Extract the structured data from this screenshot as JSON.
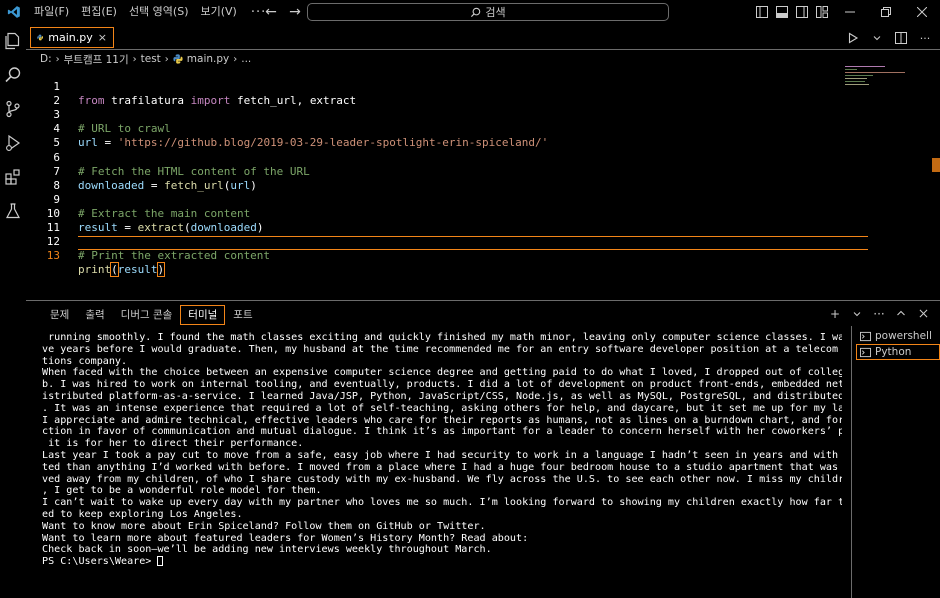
{
  "titlebar": {
    "menu": [
      "파일(F)",
      "편집(E)",
      "선택 영역(S)",
      "보기(V)"
    ],
    "more": "···",
    "search_label": "검색"
  },
  "tab": {
    "filename": "main.py",
    "close": "×"
  },
  "breadcrumb": {
    "parts": [
      "D:",
      "부트캠프 11기",
      "test",
      "main.py",
      "..."
    ]
  },
  "code": {
    "line_numbers": [
      "1",
      "2",
      "3",
      "4",
      "5",
      "6",
      "7",
      "8",
      "9",
      "10",
      "11",
      "12",
      "13"
    ],
    "active_line": "13",
    "l1": {
      "kw1": "from",
      "mod": " trafilatura ",
      "kw2": "import",
      "rest": " fetch_url, extract"
    },
    "l3": "# URL to crawl",
    "l4": {
      "var": "url",
      "op": " = ",
      "str": "'https://github.blog/2019-03-29-leader-spotlight-erin-spiceland/'"
    },
    "l6": "# Fetch the HTML content of the URL",
    "l7": {
      "var": "downloaded",
      "op": " = ",
      "fn": "fetch_url",
      "open": "(",
      "arg": "url",
      "close": ")"
    },
    "l9": "# Extract the main content",
    "l10": {
      "var": "result",
      "op": " = ",
      "fn": "extract",
      "open": "(",
      "arg": "downloaded",
      "close": ")"
    },
    "l12": "# Print the extracted content",
    "l13": {
      "fn": "print",
      "open": "(",
      "arg": "result",
      "close": ")"
    }
  },
  "panel": {
    "tabs": [
      "문제",
      "출력",
      "디버그 콘솔",
      "터미널",
      "포트"
    ],
    "active_tab": "터미널"
  },
  "terminal": {
    "lines": [
      " running smoothly. I found the math classes exciting and quickly finished my math minor, leaving only computer science classes. I was looking at about fi",
      "ve years before I would graduate. Then, my husband at the time recommended me for an entry software developer position at a telecom and digital communica",
      "tions company.",
      "When faced with the choice between an expensive computer science degree and getting paid to do what I loved, I dropped out of college and accepted the jo",
      "b. I was hired to work on internal tooling, and eventually, products. I did a lot of development on product front-ends, embedded network devices, and a d",
      "istributed platform-as-a-service. I learned Java/JSP, Python, JavaScript/CSS, Node.js, as well as MySQL, PostgreSQL, and distributed systems architecture",
      ". It was an intense experience that required a lot of self-teaching, asking others for help, and daycare, but it set me up for my later successes.",
      "I appreciate and admire technical, effective leaders who care for their reports as humans, not as lines on a burndown chart, and forego heavy-handed dire",
      "ction in favor of communication and mutual dialogue. I think it’s as important for a leader to concern herself with her coworkers’ personal well-being as",
      " it is for her to direct their performance.",
      "Last year I took a pay cut to move from a safe, easy job where I had security to work in a language I hadn’t seen in years and with systems more complica",
      "ted than anything I’d worked with before. I moved from a place where I had a huge four bedroom house to a studio apartment that was twice the price. I mo",
      "ved away from my children, of who I share custody with my ex-husband. We fly across the U.S. to see each other now. I miss my children every day. However",
      ", I get to be a wonderful role model for them.",
      "I can’t wait to wake up every day with my partner who loves me so much. I’m looking forward to showing my children exactly how far they can go. I’m excit",
      "ed to keep exploring Los Angeles.",
      "Want to know more about Erin Spiceland? Follow them on GitHub or Twitter.",
      "Want to learn more about featured leaders for Women’s History Month? Read about:",
      "Check back in soon—we’ll be adding new interviews weekly throughout March."
    ],
    "prompt": "PS C:\\Users\\Weare> "
  },
  "terminal_list": [
    "powershell",
    "Python"
  ],
  "colors": {
    "focus_border": "#f38518",
    "background": "#000000"
  }
}
